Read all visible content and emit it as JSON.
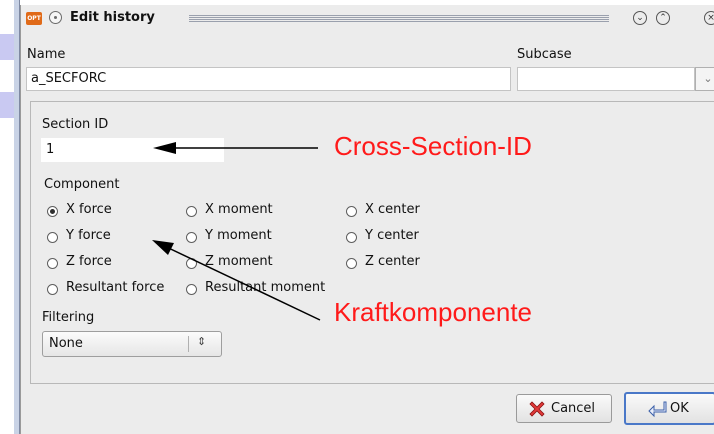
{
  "window": {
    "title": "Edit history",
    "app_icon_text": "OPT"
  },
  "form": {
    "name_label": "Name",
    "name_value": "a_SECFORC",
    "subcase_label": "Subcase",
    "subcase_value": "",
    "section_id_label": "Section ID",
    "section_id_value": "1",
    "component_label": "Component",
    "components": [
      {
        "label": "X force",
        "selected": true
      },
      {
        "label": "Y force",
        "selected": false
      },
      {
        "label": "Z force",
        "selected": false
      },
      {
        "label": "Resultant force",
        "selected": false
      },
      {
        "label": "X moment",
        "selected": false
      },
      {
        "label": "Y moment",
        "selected": false
      },
      {
        "label": "Z moment",
        "selected": false
      },
      {
        "label": "Resultant moment",
        "selected": false
      },
      {
        "label": "X center",
        "selected": false
      },
      {
        "label": "Y center",
        "selected": false
      },
      {
        "label": "Z center",
        "selected": false
      }
    ],
    "filtering_label": "Filtering",
    "filtering_value": "None"
  },
  "buttons": {
    "cancel_label": "Cancel",
    "ok_label": "OK"
  },
  "annotations": {
    "section_id": "Cross-Section-ID",
    "component": "Kraftkomponente",
    "color": "#ff1a1a"
  }
}
